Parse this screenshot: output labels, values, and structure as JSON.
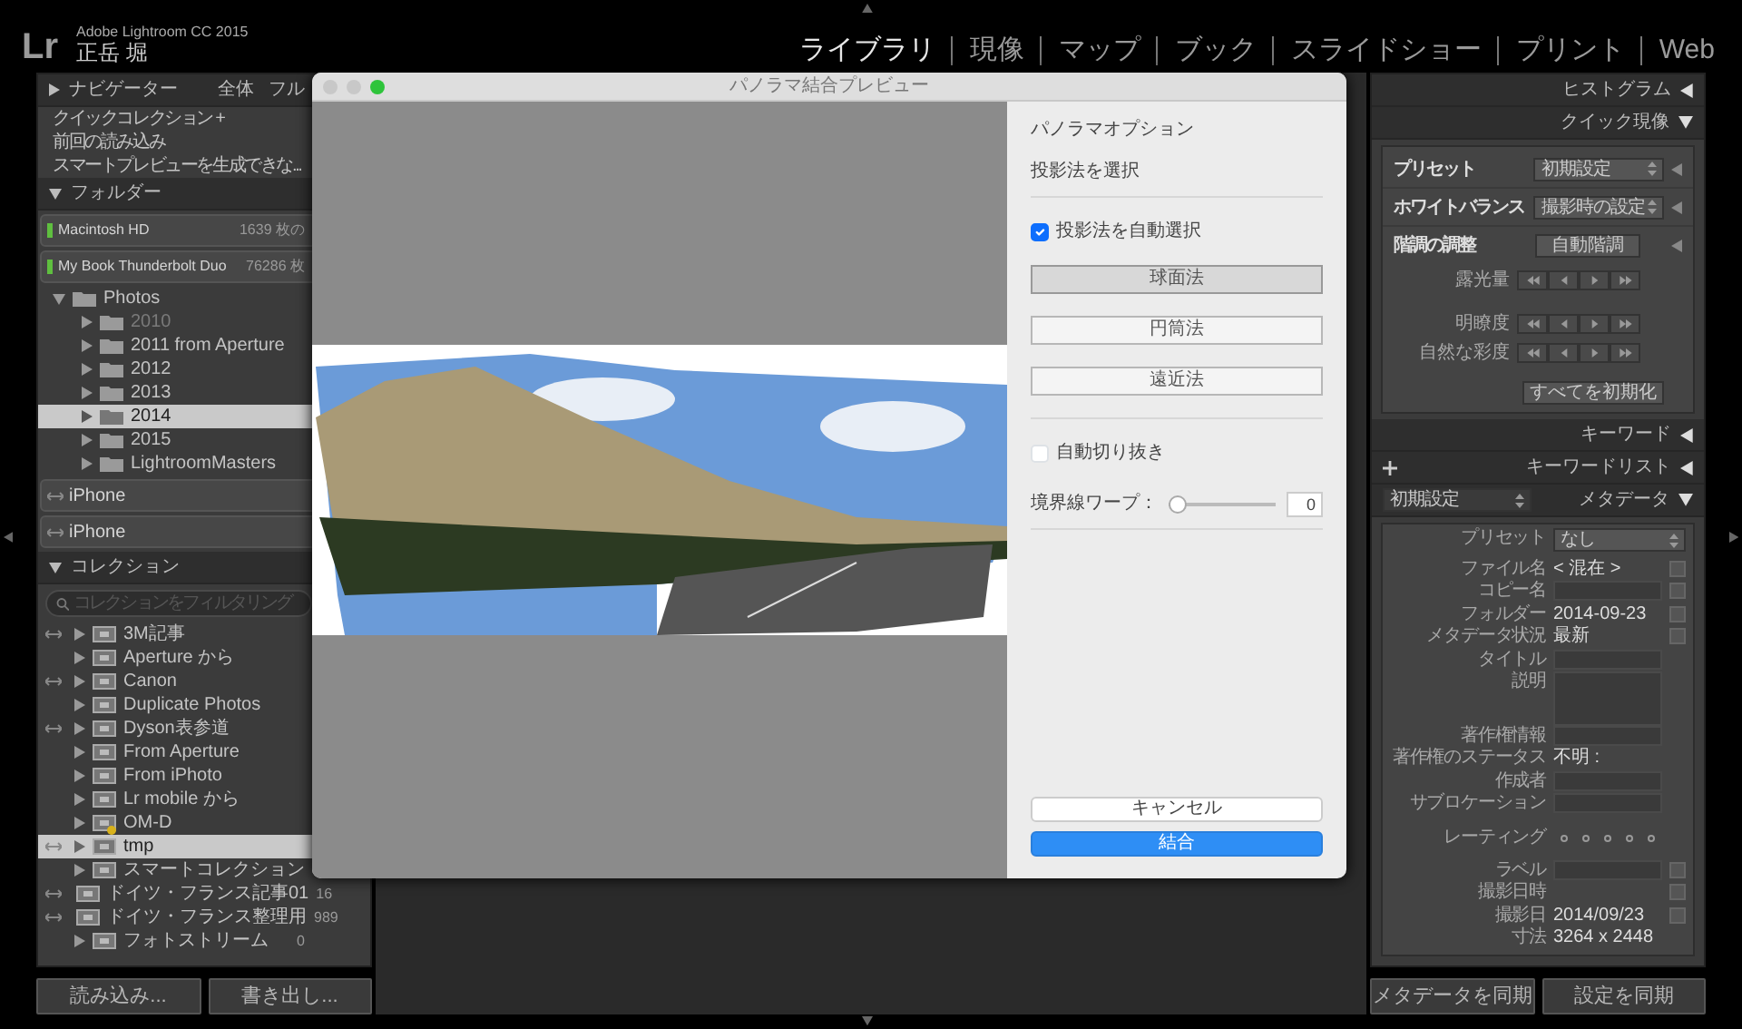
{
  "app": {
    "logo": "Lr",
    "product": "Adobe Lightroom CC 2015",
    "user": "正岳 堀"
  },
  "modules": [
    {
      "label": "ライブラリ",
      "selected": true
    },
    {
      "label": "現像",
      "selected": false
    },
    {
      "label": "マップ",
      "selected": false
    },
    {
      "label": "ブック",
      "selected": false
    },
    {
      "label": "スライドショー",
      "selected": false
    },
    {
      "label": "プリント",
      "selected": false
    },
    {
      "label": "Web",
      "selected": false
    }
  ],
  "left_panel": {
    "navigator": {
      "title": "ナビゲーター",
      "expanded": false,
      "options": [
        "全体",
        "フル"
      ]
    },
    "catalog_items": [
      "クイックコレクション +",
      "前回の読み込み",
      "スマートプレビューを生成できな..."
    ],
    "folders": {
      "title": "フォルダー",
      "expanded": true,
      "volumes": [
        {
          "name": "Macintosh HD",
          "count": "1639 枚の"
        },
        {
          "name": "My Book Thunderbolt Duo",
          "count": "76286 枚"
        }
      ],
      "tree": [
        {
          "name": "Photos",
          "expanded": true,
          "selected": false,
          "offline": false,
          "children": [
            {
              "name": "2010",
              "expanded": false,
              "selected": false,
              "offline": true
            },
            {
              "name": "2011 from Aperture",
              "expanded": false,
              "selected": false,
              "offline": false
            },
            {
              "name": "2012",
              "expanded": false,
              "selected": false,
              "offline": false
            },
            {
              "name": "2013",
              "expanded": false,
              "selected": false,
              "offline": false
            },
            {
              "name": "2014",
              "expanded": false,
              "selected": true,
              "offline": false
            },
            {
              "name": "2015",
              "expanded": false,
              "selected": false,
              "offline": false
            },
            {
              "name": "LightroomMasters",
              "expanded": false,
              "selected": false,
              "offline": false
            }
          ]
        }
      ],
      "devices": [
        "iPhone",
        "iPhone"
      ]
    },
    "collections": {
      "title": "コレクション",
      "expanded": true,
      "search_placeholder": "コレクションをフィルタリング",
      "items": [
        {
          "name": "3M記事",
          "synced": true,
          "selected": false,
          "badge": false
        },
        {
          "name": "Aperture から",
          "synced": false,
          "selected": false,
          "badge": false
        },
        {
          "name": "Canon",
          "synced": true,
          "selected": false,
          "badge": false
        },
        {
          "name": "Duplicate Photos",
          "synced": false,
          "selected": false,
          "badge": false
        },
        {
          "name": "Dyson表参道",
          "synced": true,
          "selected": false,
          "badge": false
        },
        {
          "name": "From Aperture",
          "synced": false,
          "selected": false,
          "badge": false
        },
        {
          "name": "From iPhoto",
          "synced": false,
          "selected": false,
          "badge": false
        },
        {
          "name": "Lr mobile から",
          "synced": false,
          "selected": false,
          "badge": false
        },
        {
          "name": "OM-D",
          "synced": false,
          "selected": false,
          "badge": true
        },
        {
          "name": "tmp",
          "synced": true,
          "selected": true,
          "badge": false
        },
        {
          "name": "スマートコレクション",
          "synced": false,
          "selected": false,
          "badge": false
        },
        {
          "name": "ドイツ・フランス記事01",
          "synced": true,
          "selected": false,
          "badge": false,
          "count": "16"
        },
        {
          "name": "ドイツ・フランス整理用",
          "synced": true,
          "selected": false,
          "badge": false,
          "count": "989"
        },
        {
          "name": "フォトストリーム",
          "synced": false,
          "selected": false,
          "badge": false,
          "count": "0"
        }
      ]
    },
    "buttons": [
      "読み込み...",
      "書き出し..."
    ]
  },
  "dialog": {
    "title": "パノラマ結合プレビュー",
    "options_title": "パノラマオプション",
    "projection_label": "投影法を選択",
    "auto_select": {
      "label": "投影法を自動選択",
      "checked": true
    },
    "projections": [
      {
        "label": "球面法",
        "selected": true
      },
      {
        "label": "円筒法",
        "selected": false
      },
      {
        "label": "遠近法",
        "selected": false
      }
    ],
    "auto_crop": {
      "label": "自動切り抜き",
      "checked": false
    },
    "boundary_warp": {
      "label": "境界線ワープ：",
      "level": 0,
      "value": "0"
    },
    "buttons": [
      {
        "label": "キャンセル",
        "kind": "secondary"
      },
      {
        "label": "結合",
        "kind": "primary"
      }
    ]
  },
  "right_panel": {
    "histogram": {
      "title": "ヒストグラム",
      "expanded": false
    },
    "quick_develop": {
      "title": "クイック現像",
      "expanded": true,
      "rows": [
        {
          "label": "プリセット",
          "value": "初期設定"
        },
        {
          "label": "ホワイトバランス",
          "value": "撮影時の設定"
        }
      ],
      "tone": {
        "label": "階調の調整",
        "auto_button": "自動階調",
        "adjustments": [
          "露光量",
          "明瞭度",
          "自然な彩度"
        ],
        "reset_button": "すべてを初期化"
      }
    },
    "keywording": {
      "title": "キーワード",
      "expanded": false
    },
    "keyword_list": {
      "title": "キーワードリスト",
      "expanded": false
    },
    "metadata": {
      "title": "メタデータ",
      "expanded": true,
      "preset_menu": "初期設定",
      "preset_label": "プリセット",
      "preset_value": "なし",
      "fields": [
        {
          "label": "ファイル名",
          "kind": "value",
          "value": "< 混在 >",
          "action": true
        },
        {
          "label": "コピー名",
          "kind": "input",
          "action": true
        },
        {
          "label": "フォルダー",
          "kind": "value",
          "value": "2014-09-23",
          "action": true
        },
        {
          "label": "メタデータ状況",
          "kind": "value",
          "value": "最新",
          "action": true
        },
        {
          "label": "タイトル",
          "kind": "input",
          "action": false
        },
        {
          "label": "説明",
          "kind": "area",
          "action": false
        },
        {
          "label": "著作権情報",
          "kind": "input",
          "action": false
        },
        {
          "label": "著作権のステータス",
          "kind": "value",
          "value": "不明 :",
          "action": false
        },
        {
          "label": "作成者",
          "kind": "input",
          "action": false
        },
        {
          "label": "サブロケーション",
          "kind": "input",
          "action": false
        },
        {
          "label": "レーティング",
          "kind": "rating",
          "stars": 0,
          "action": false
        },
        {
          "label": "ラベル",
          "kind": "input",
          "action": true
        },
        {
          "label": "撮影日時",
          "kind": "value",
          "action": true
        },
        {
          "label": "撮影日",
          "kind": "value",
          "value": "2014/09/23",
          "action": true
        },
        {
          "label": "寸法",
          "kind": "value",
          "value": "3264 x 2448",
          "action": false
        }
      ]
    },
    "buttons": [
      "メタデータを同期",
      "設定を同期"
    ]
  }
}
